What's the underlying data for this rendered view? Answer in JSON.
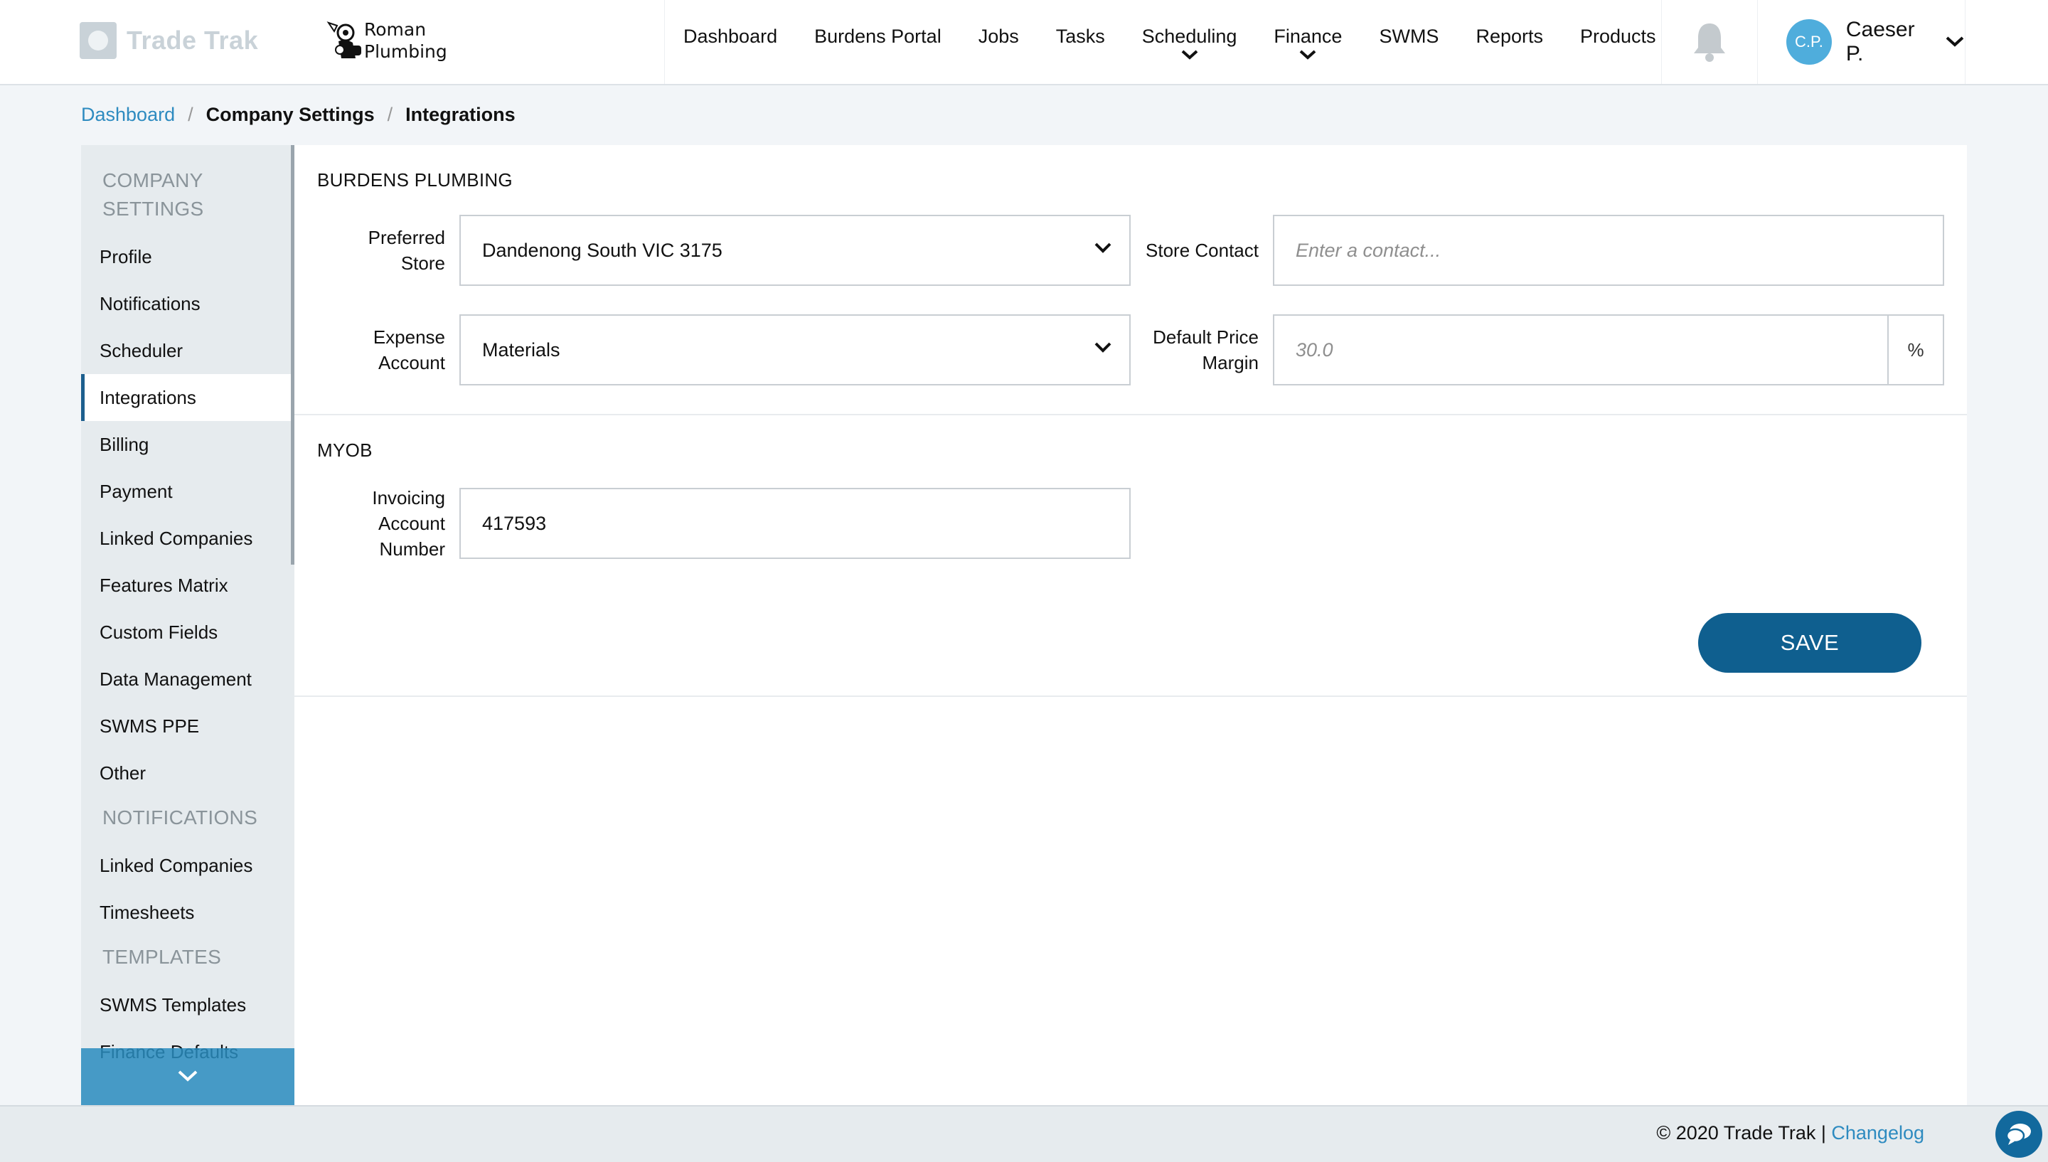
{
  "app": {
    "brand_name": "Trade Trak",
    "company_name_line1": "Roman",
    "company_name_line2": "Plumbing"
  },
  "nav": {
    "items": [
      {
        "label": "Dashboard",
        "dropdown": false
      },
      {
        "label": "Burdens Portal",
        "dropdown": false
      },
      {
        "label": "Jobs",
        "dropdown": false
      },
      {
        "label": "Tasks",
        "dropdown": false
      },
      {
        "label": "Scheduling",
        "dropdown": true
      },
      {
        "label": "Finance",
        "dropdown": true
      },
      {
        "label": "SWMS",
        "dropdown": false
      },
      {
        "label": "Reports",
        "dropdown": false
      },
      {
        "label": "Products",
        "dropdown": false
      }
    ],
    "bell_icon": "bell-icon",
    "user_initials": "C.P.",
    "user_name": "Caeser P."
  },
  "breadcrumb": {
    "home": "Dashboard",
    "parent": "Company Settings",
    "current": "Integrations",
    "separator": "/"
  },
  "sidebar": {
    "section_company_line1": "COMPANY",
    "section_company_line2": "SETTINGS",
    "company_items": [
      "Profile",
      "Notifications",
      "Scheduler",
      "Integrations",
      "Billing",
      "Payment",
      "Linked Companies",
      "Features Matrix",
      "Custom Fields",
      "Data Management",
      "SWMS PPE",
      "Other"
    ],
    "active_item": "Integrations",
    "section_notifications": "NOTIFICATIONS",
    "notification_items": [
      "Linked Companies",
      "Timesheets"
    ],
    "section_templates": "TEMPLATES",
    "template_items": [
      "SWMS Templates",
      "Finance Defaults"
    ]
  },
  "burdens": {
    "heading": "BURDENS PLUMBING",
    "preferred_store_label_1": "Preferred",
    "preferred_store_label_2": "Store",
    "preferred_store_value": "Dandenong South VIC 3175",
    "store_contact_label": "Store Contact",
    "store_contact_placeholder": "Enter a contact...",
    "expense_account_label_1": "Expense",
    "expense_account_label_2": "Account",
    "expense_account_value": "Materials",
    "margin_label_1": "Default Price",
    "margin_label_2": "Margin",
    "margin_placeholder": "30.0",
    "margin_unit": "%"
  },
  "myob": {
    "heading": "MYOB",
    "invoicing_label_1": "Invoicing",
    "invoicing_label_2": "Account",
    "invoicing_label_3": "Number",
    "invoicing_value": "417593"
  },
  "actions": {
    "save_label": "SAVE"
  },
  "footer": {
    "copyright": "© 2020 Trade Trak |",
    "changelog": "Changelog"
  },
  "colors": {
    "accent": "#0f5f8f",
    "link": "#2e8bc0",
    "avatar": "#4faddc",
    "sidebar_bg": "#e6ebee"
  }
}
